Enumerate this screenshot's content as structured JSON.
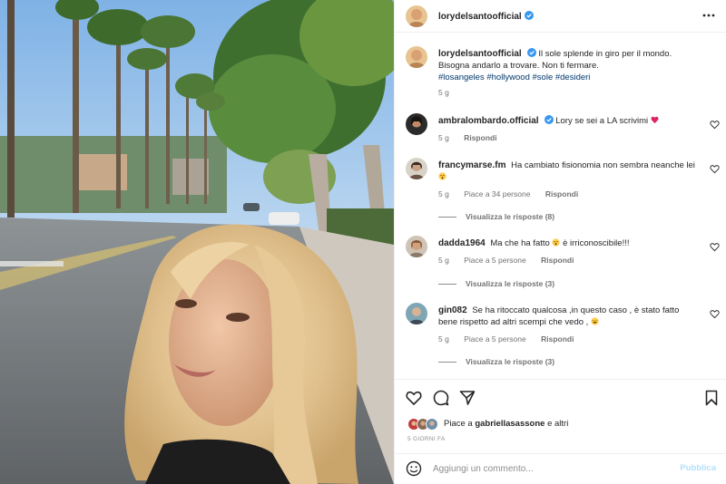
{
  "post": {
    "author": "lorydelsantoofficial",
    "photo_alt": "selfie of a blonde woman on a palm-lined street"
  },
  "caption": {
    "username": "lorydelsantoofficial",
    "text": "Il sole splende in giro per il mondo. Bisogna andarlo a trovare. Non ti fermare.",
    "hashtags": "#losangeles #hollywood #sole #desideri",
    "time": "5 g"
  },
  "comments": [
    {
      "username": "ambralombardo.official",
      "verified": true,
      "text": "Lory se sei a LA scrivimi",
      "emoji": "red-heart",
      "time": "5 g",
      "likes": "",
      "reply": "Rispondi",
      "view_replies": ""
    },
    {
      "username": "francymarse.fm",
      "verified": false,
      "text": "Ha cambiato fisionomia non sembra neanche lei",
      "emoji": "astonished-face",
      "time": "5 g",
      "likes": "Piace a 34 persone",
      "reply": "Rispondi",
      "view_replies": "Visualizza le risposte (8)"
    },
    {
      "username": "dadda1964",
      "verified": false,
      "text": "Ma che ha fatto",
      "emoji": "astonished-face",
      "text_after": "è irriconoscibile!!!",
      "time": "5 g",
      "likes": "Piace a 5 persone",
      "reply": "Rispondi",
      "view_replies": "Visualizza le risposte (3)"
    },
    {
      "username": "gin082",
      "verified": false,
      "text": "Se ha ritoccato qualcosa ,in questo caso , è stato fatto bene rispetto ad altri scempi che vedo ,",
      "emoji": "grinning-face",
      "time": "5 g",
      "likes": "Piace a 5 persone",
      "reply": "Rispondi",
      "view_replies": "Visualizza le risposte (3)"
    }
  ],
  "likes_summary": {
    "prefix": "Piace a",
    "user": "gabriellasassone",
    "suffix": "e altri"
  },
  "date_label": "5 GIORNI FA",
  "add_comment": {
    "placeholder": "Aggiungi un commento...",
    "publish": "Pubblica"
  },
  "icons": [
    "more-icon",
    "verified-icon",
    "heart-icon",
    "comment-icon",
    "share-icon",
    "bookmark-icon",
    "emoji-icon"
  ],
  "colors": {
    "verified": "#3897f0",
    "link": "#00376b",
    "muted": "#737373",
    "publish_disabled": "#b2dffc",
    "heart_red": "#ed4956"
  }
}
